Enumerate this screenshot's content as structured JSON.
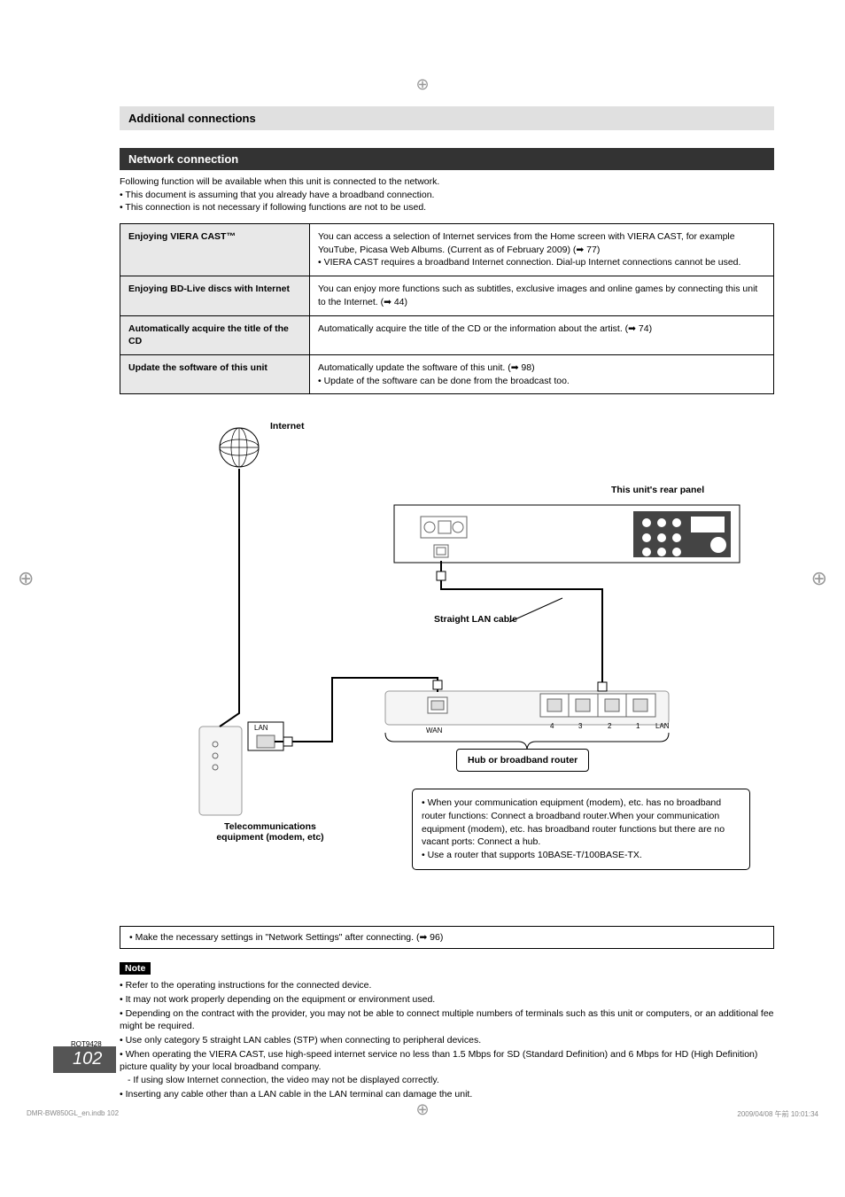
{
  "header": {
    "section_title": "Additional connections",
    "subsection_title": "Network connection"
  },
  "intro": {
    "line1": "Following function will be available when this unit is connected to the network.",
    "bullet1": "This document is assuming that you already have a broadband connection.",
    "bullet2": "This connection is not necessary if following functions are not to be used."
  },
  "table": {
    "rows": [
      {
        "label": "Enjoying VIERA CAST™",
        "desc": "You can access a selection of Internet services from the Home screen with VIERA CAST, for example YouTube, Picasa Web Albums. (Current as of February 2009) (➡ 77)\n• VIERA CAST requires a broadband Internet connection. Dial-up Internet connections cannot be used."
      },
      {
        "label": "Enjoying BD-Live discs with Internet",
        "desc": "You can enjoy more functions such as subtitles, exclusive images and  online games by connecting this unit to the Internet. (➡ 44)"
      },
      {
        "label": "Automatically acquire the title of the CD",
        "desc": "Automatically acquire the title of the CD or the information about the artist. (➡ 74)"
      },
      {
        "label": "Update the software of this unit",
        "desc": "Automatically update the software of this unit. (➡ 98)\n• Update of the software can be done from the broadcast too."
      }
    ]
  },
  "diagram": {
    "internet": "Internet",
    "rear_panel": "This unit's rear panel",
    "lan_cable": "Straight LAN cable",
    "hub_router": "Hub or broadband router",
    "telecom": "Telecommunications equipment (modem, etc)",
    "wan": "WAN",
    "lan_ports": "LAN",
    "lan_label": "LAN",
    "port4": "4",
    "port3": "3",
    "port2": "2",
    "port1": "1",
    "callout_b1": "When your communication equipment (modem), etc. has no broadband router functions: Connect a broadband router.When your communication equipment (modem), etc. has broadband router functions but there are no vacant ports: Connect a hub.",
    "callout_b2": "Use a router that supports 10BASE-T/100BASE-TX."
  },
  "settings_box": "• Make the necessary settings in \"Network Settings\" after connecting. (➡ 96)",
  "notes": {
    "label": "Note",
    "items": [
      "Refer to the operating instructions for the connected device.",
      "It may not work properly depending on the equipment or environment used.",
      "Depending on the contract with the provider, you may not be able to connect multiple numbers of terminals such as this unit or computers, or an additional fee might be required.",
      "Use only category 5 straight LAN cables (STP) when connecting to peripheral devices.",
      "When operating the VIERA CAST, use high-speed internet service no less than 1.5 Mbps for SD (Standard Definition) and 6 Mbps for HD (High Definition) picture quality by your local broadband company.",
      "Inserting any cable other than a LAN cable in the LAN terminal can damage the unit."
    ],
    "sub_item5": "- If using slow Internet connection, the video may not be displayed correctly."
  },
  "footer": {
    "rqt": "RQT9428",
    "page_number": "102",
    "print_left": "DMR-BW850GL_en.indb   102",
    "print_right": "2009/04/08   午前 10:01:34"
  }
}
